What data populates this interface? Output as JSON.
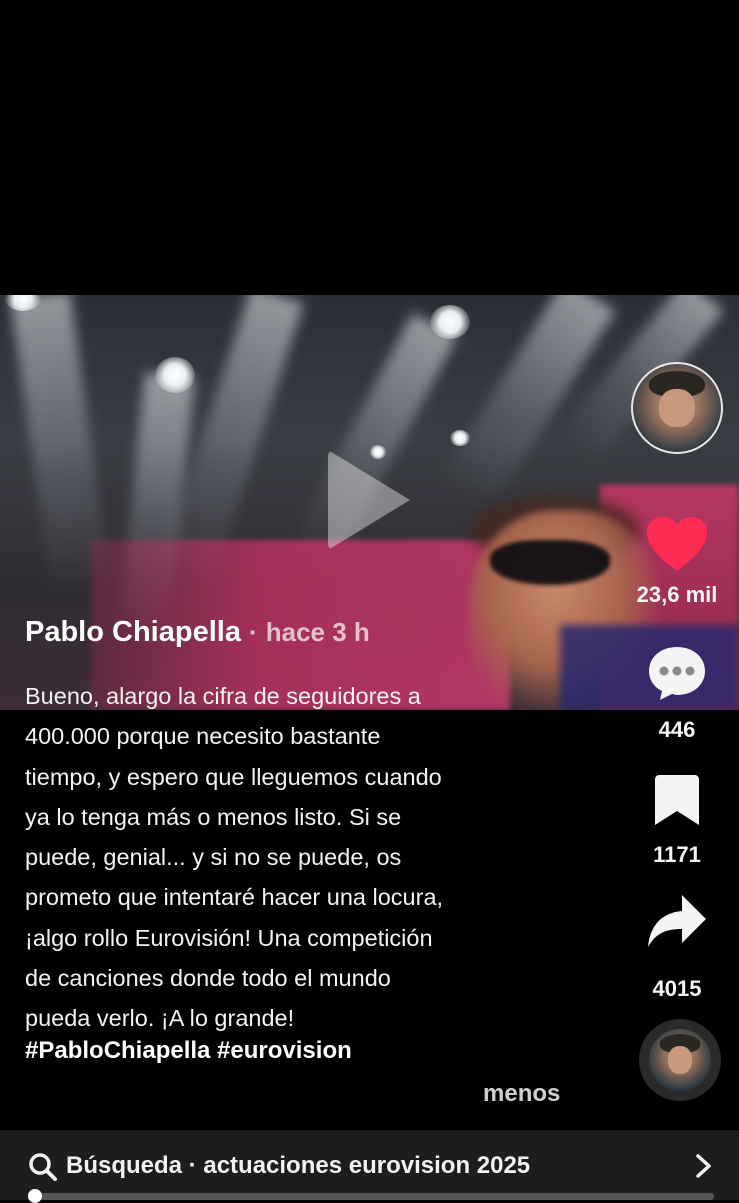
{
  "post": {
    "author": "Pablo Chiapella",
    "separator": "·",
    "time": "hace 3 h",
    "caption_lines": [
      "Bueno, alargo la cifra de seguidores a",
      "400.000 porque necesito bastante",
      "tiempo, y espero que lleguemos cuando",
      "ya lo tenga más o menos listo. Si se",
      "puede, genial... y si no se puede, os",
      "prometo que intentaré hacer una locura,",
      "¡algo rollo Eurovisión! Una competición",
      "de canciones donde todo el mundo",
      "pueda verlo. ¡A lo grande!"
    ],
    "hashtags": "#PabloChiapella #eurovision",
    "less_label": "menos"
  },
  "actions": {
    "likes": "23,6 mil",
    "comments": "446",
    "saves": "1171",
    "shares": "4015"
  },
  "icons": {
    "like": "heart-icon",
    "comment": "comment-bubble-icon",
    "save": "bookmark-icon",
    "share": "share-arrow-icon",
    "search": "search-icon",
    "chevron": "chevron-right-icon",
    "play": "play-icon"
  },
  "colors": {
    "like_active": "#fe2c55",
    "background": "#000000",
    "search_bar": "#1d1d1f"
  },
  "search": {
    "label": "Búsqueda · actuaciones eurovision 2025"
  },
  "playback": {
    "progress_fraction": 0.01
  }
}
